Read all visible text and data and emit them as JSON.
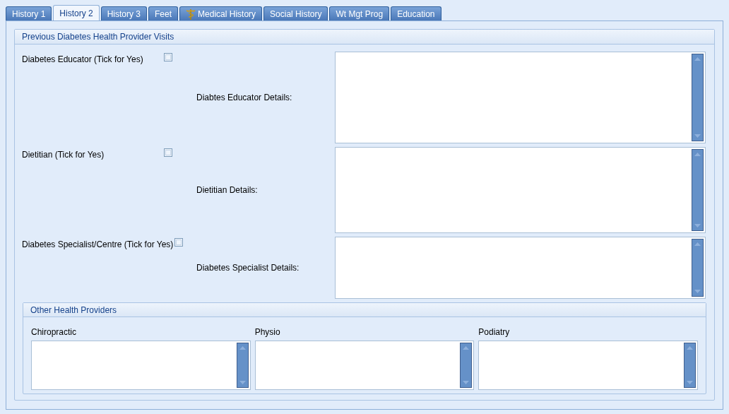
{
  "tabs": [
    {
      "label": "History 1",
      "selected": false,
      "kind": "plain"
    },
    {
      "label": "History 2",
      "selected": true,
      "kind": "plain"
    },
    {
      "label": "History 3",
      "selected": false,
      "kind": "plain"
    },
    {
      "label": "Feet",
      "selected": false,
      "kind": "plain"
    },
    {
      "label": "Medical History",
      "selected": false,
      "kind": "with-icon"
    },
    {
      "label": "Social History",
      "selected": false,
      "kind": "plain"
    },
    {
      "label": "Wt Mgt Prog",
      "selected": false,
      "kind": "plain"
    },
    {
      "label": "Education",
      "selected": false,
      "kind": "plain"
    }
  ],
  "visits": {
    "title": "Previous Diabetes Health Provider Visits",
    "rows": [
      {
        "label": "Diabetes Educator (Tick for Yes)",
        "checked": false,
        "details_label": "Diabtes Educator Details:"
      },
      {
        "label": "Dietitian (Tick for Yes)",
        "checked": false,
        "details_label": "Dietitian Details:"
      },
      {
        "label": "Diabetes Specialist/Centre (Tick for Yes)",
        "checked": false,
        "details_label": "Diabetes Specialist Details:"
      }
    ]
  },
  "other_providers": {
    "title": "Other Health Providers",
    "fields": [
      {
        "label": "Chiropractic"
      },
      {
        "label": "Physio"
      },
      {
        "label": "Podiatry"
      }
    ]
  }
}
